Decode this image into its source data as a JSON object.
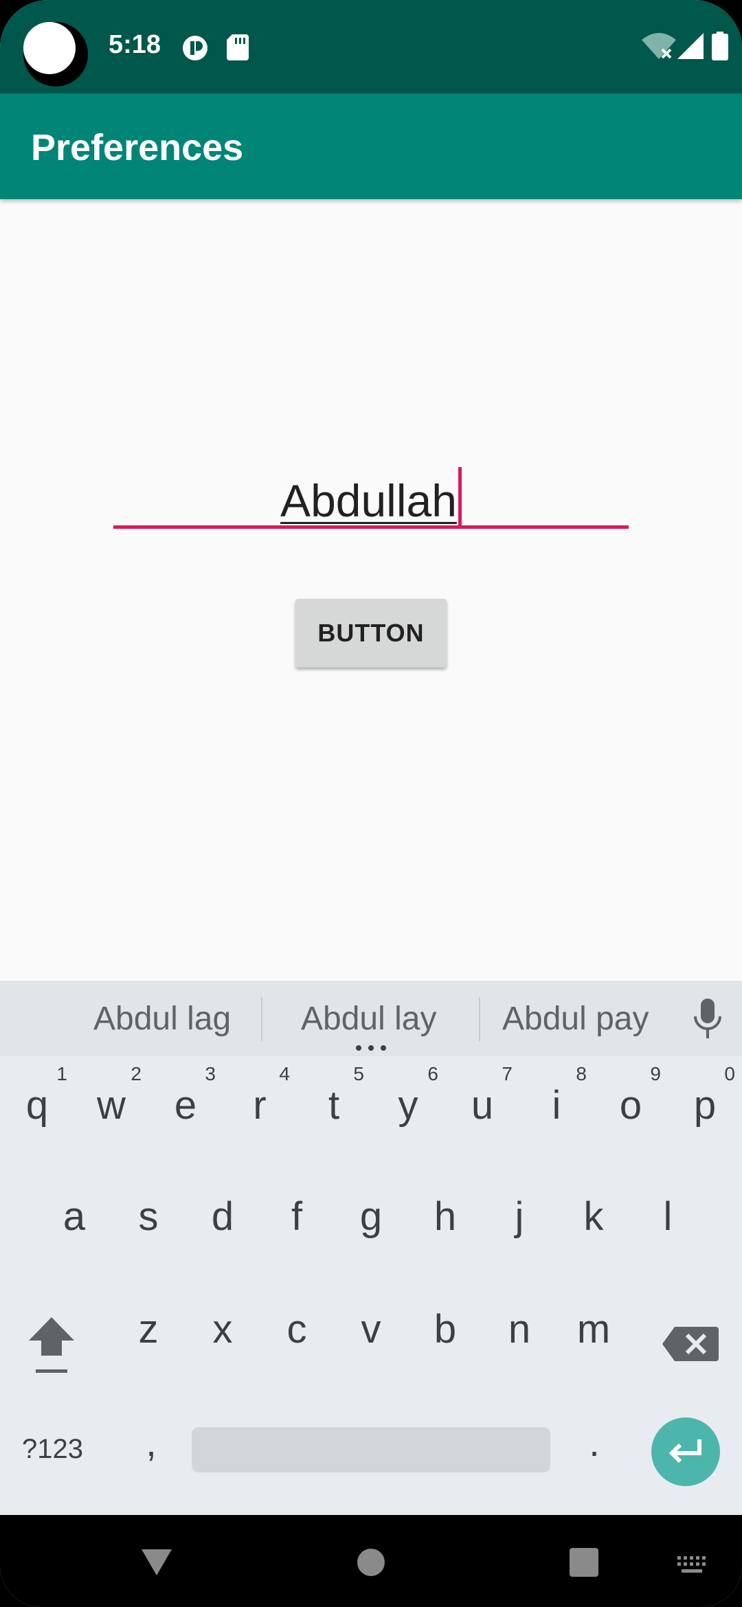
{
  "status_bar": {
    "time": "5:18",
    "icons": [
      "camera-cutout",
      "notification-app-icon",
      "sd-card-icon",
      "wifi-no-internet-icon",
      "cell-signal-icon",
      "battery-icon"
    ]
  },
  "app_bar": {
    "title": "Preferences"
  },
  "form": {
    "name_value": "Abdullah",
    "button_label": "BUTTON",
    "accent_color": "#d81b60"
  },
  "keyboard": {
    "suggestions": [
      "Abdul lag",
      "Abdul lay",
      "Abdul pay"
    ],
    "rows": [
      [
        {
          "char": "q",
          "hint": "1"
        },
        {
          "char": "w",
          "hint": "2"
        },
        {
          "char": "e",
          "hint": "3"
        },
        {
          "char": "r",
          "hint": "4"
        },
        {
          "char": "t",
          "hint": "5"
        },
        {
          "char": "y",
          "hint": "6"
        },
        {
          "char": "u",
          "hint": "7"
        },
        {
          "char": "i",
          "hint": "8"
        },
        {
          "char": "o",
          "hint": "9"
        },
        {
          "char": "p",
          "hint": "0"
        }
      ],
      [
        {
          "char": "a"
        },
        {
          "char": "s"
        },
        {
          "char": "d"
        },
        {
          "char": "f"
        },
        {
          "char": "g"
        },
        {
          "char": "h"
        },
        {
          "char": "j"
        },
        {
          "char": "k"
        },
        {
          "char": "l"
        }
      ],
      [
        {
          "char": "z"
        },
        {
          "char": "x"
        },
        {
          "char": "c"
        },
        {
          "char": "v"
        },
        {
          "char": "b"
        },
        {
          "char": "n"
        },
        {
          "char": "m"
        }
      ]
    ],
    "symbols_label": "?123",
    "comma_label": ",",
    "period_label": ".",
    "enter_color": "#4db6ac"
  },
  "nav_bar": {
    "buttons": [
      "back-icon",
      "home-icon",
      "recents-icon",
      "keyboard-switcher-icon"
    ]
  },
  "colors": {
    "status_bar": "#00574b",
    "app_bar": "#008577",
    "background": "#fafafa"
  }
}
